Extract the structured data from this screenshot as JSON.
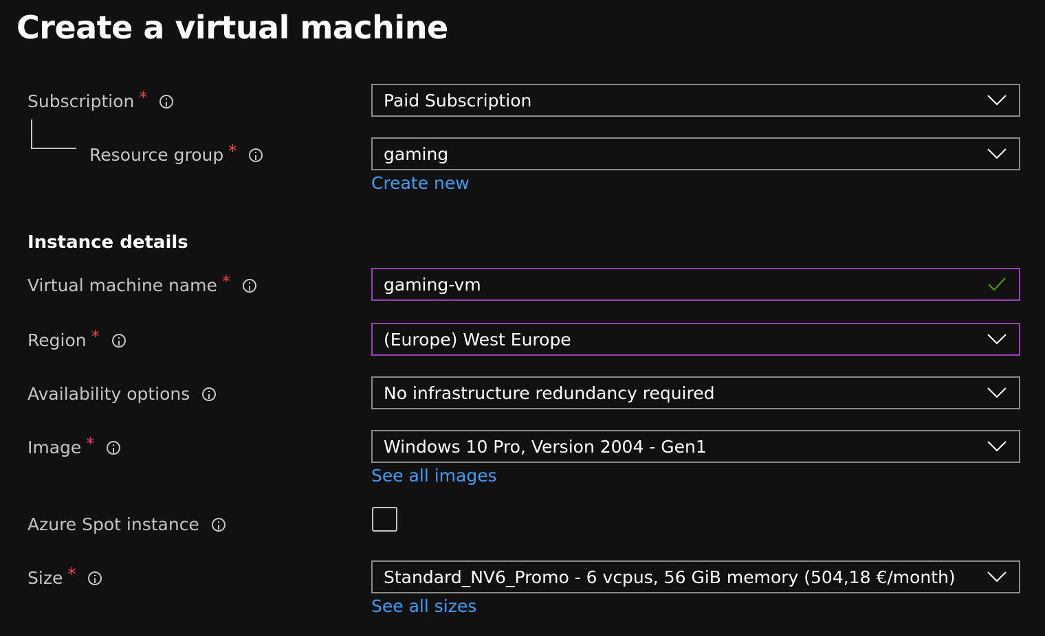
{
  "page": {
    "title": "Create a virtual machine"
  },
  "fields": {
    "subscription": {
      "label": "Subscription",
      "required_mark": "*",
      "value": "Paid Subscription"
    },
    "resource_group": {
      "label": "Resource group",
      "required_mark": "*",
      "value": "gaming",
      "link": "Create new"
    },
    "section_heading": "Instance details",
    "vm_name": {
      "label": "Virtual machine name",
      "required_mark": "*",
      "value": "gaming-vm",
      "status_icon": "checkmark-icon"
    },
    "region": {
      "label": "Region",
      "required_mark": "*",
      "value": "(Europe) West Europe"
    },
    "availability": {
      "label": "Availability options",
      "value": "No infrastructure redundancy required"
    },
    "image": {
      "label": "Image",
      "required_mark": "*",
      "value": "Windows 10 Pro, Version 2004 - Gen1",
      "link": "See all images"
    },
    "spot": {
      "label": "Azure Spot instance",
      "checked": false
    },
    "size": {
      "label": "Size",
      "required_mark": "*",
      "value": "Standard_NV6_Promo - 6 vcpus, 56 GiB memory (504,18 €/month)",
      "link": "See all sizes"
    }
  },
  "colors": {
    "background": "#111111",
    "label": "#c4c4c4",
    "required": "#f1404b",
    "link": "#3f9cf3",
    "focus_border": "#9b3fb5",
    "valid_check": "#57a300"
  }
}
